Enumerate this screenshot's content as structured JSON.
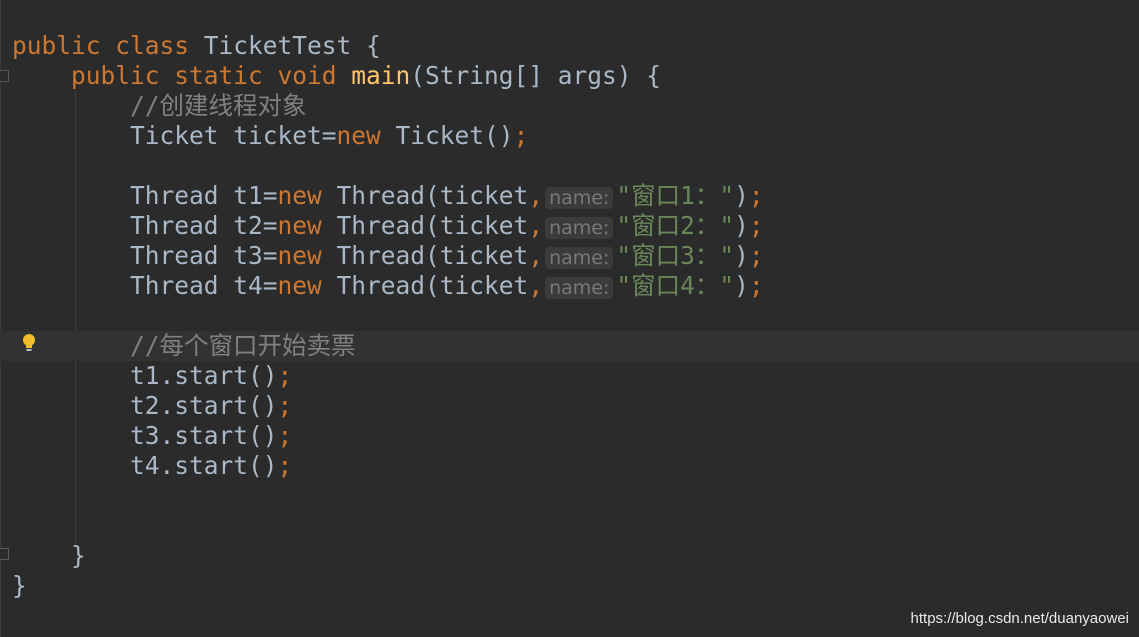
{
  "editor": {
    "colors": {
      "background": "#2b2b2b",
      "keyword": "#cc7832",
      "text": "#a9b7c6",
      "method": "#ffc66d",
      "string": "#6a8759",
      "comment": "#808080"
    },
    "lines": [
      {
        "indent": 0,
        "tokens": [
          [
            "public class ",
            "kw"
          ],
          [
            "TicketTest {",
            "tx"
          ]
        ]
      },
      {
        "indent": 4,
        "tokens": [
          [
            "public static void ",
            "kw"
          ],
          [
            "main",
            "fn"
          ],
          [
            "(String[] args) {",
            "tx"
          ]
        ]
      },
      {
        "indent": 8,
        "tokens": [
          [
            "//创建线程对象",
            "cm"
          ]
        ]
      },
      {
        "indent": 8,
        "tokens": [
          [
            "Ticket ticket=",
            "tx"
          ],
          [
            "new ",
            "kw"
          ],
          [
            "Ticket()",
            "tx"
          ],
          [
            ";",
            "kw"
          ]
        ]
      },
      {
        "indent": 0,
        "tokens": []
      },
      {
        "indent": 8,
        "tokens": [
          [
            "Thread t1=",
            "tx"
          ],
          [
            "new ",
            "kw"
          ],
          [
            "Thread(ticket",
            "tx"
          ],
          [
            ",",
            "kw"
          ],
          [
            "name:",
            "hint"
          ],
          [
            "\"窗口1：\"",
            "st"
          ],
          [
            ")",
            "tx"
          ],
          [
            ";",
            "kw"
          ]
        ]
      },
      {
        "indent": 8,
        "tokens": [
          [
            "Thread t2=",
            "tx"
          ],
          [
            "new ",
            "kw"
          ],
          [
            "Thread(ticket",
            "tx"
          ],
          [
            ",",
            "kw"
          ],
          [
            "name:",
            "hint"
          ],
          [
            "\"窗口2：\"",
            "st"
          ],
          [
            ")",
            "tx"
          ],
          [
            ";",
            "kw"
          ]
        ]
      },
      {
        "indent": 8,
        "tokens": [
          [
            "Thread t3=",
            "tx"
          ],
          [
            "new ",
            "kw"
          ],
          [
            "Thread(ticket",
            "tx"
          ],
          [
            ",",
            "kw"
          ],
          [
            "name:",
            "hint"
          ],
          [
            "\"窗口3：\"",
            "st"
          ],
          [
            ")",
            "tx"
          ],
          [
            ";",
            "kw"
          ]
        ]
      },
      {
        "indent": 8,
        "tokens": [
          [
            "Thread t4=",
            "tx"
          ],
          [
            "new ",
            "kw"
          ],
          [
            "Thread(ticket",
            "tx"
          ],
          [
            ",",
            "kw"
          ],
          [
            "name:",
            "hint"
          ],
          [
            "\"窗口4：\"",
            "st"
          ],
          [
            ")",
            "tx"
          ],
          [
            ";",
            "kw"
          ]
        ]
      },
      {
        "indent": 0,
        "tokens": []
      },
      {
        "indent": 8,
        "highlight": true,
        "tokens": [
          [
            "//每个窗口开始卖票",
            "cm"
          ]
        ]
      },
      {
        "indent": 8,
        "tokens": [
          [
            "t1.start()",
            "tx"
          ],
          [
            ";",
            "kw"
          ]
        ]
      },
      {
        "indent": 8,
        "tokens": [
          [
            "t2.start()",
            "tx"
          ],
          [
            ";",
            "kw"
          ]
        ]
      },
      {
        "indent": 8,
        "tokens": [
          [
            "t3.start()",
            "tx"
          ],
          [
            ";",
            "kw"
          ]
        ]
      },
      {
        "indent": 8,
        "tokens": [
          [
            "t4.start()",
            "tx"
          ],
          [
            ";",
            "kw"
          ]
        ]
      },
      {
        "indent": 0,
        "tokens": []
      },
      {
        "indent": 0,
        "tokens": []
      },
      {
        "indent": 4,
        "tokens": [
          [
            "}",
            "tx"
          ]
        ]
      },
      {
        "indent": 0,
        "tokens": [
          [
            "}",
            "tx"
          ]
        ]
      }
    ],
    "intention_icon": "lightbulb-icon"
  },
  "watermark": "https://blog.csdn.net/duanyaowei"
}
